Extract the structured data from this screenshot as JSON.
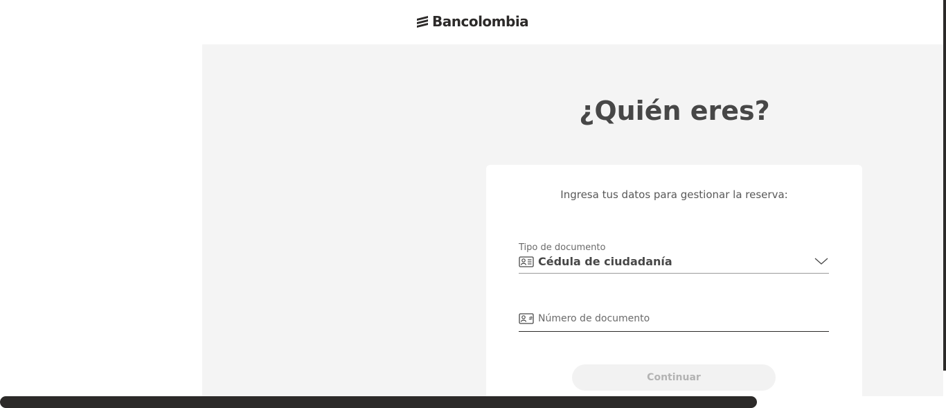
{
  "header": {
    "brand_name": "Bancolombia",
    "logo_icon": "bancolombia-logo-icon"
  },
  "page": {
    "title": "¿Quién eres?"
  },
  "form": {
    "subtitle": "Ingresa tus datos para gestionar la reserva:",
    "document_type": {
      "label": "Tipo de documento",
      "selected_value": "Cédula de ciudadanía",
      "icon": "id-card-icon",
      "dropdown_icon": "chevron-down-icon"
    },
    "document_number": {
      "value": "",
      "placeholder": "Número de documento",
      "icon": "id-card-icon"
    },
    "continue_label": "Continuar"
  },
  "colors": {
    "text_dark": "#2c2a29",
    "background_gray": "#f4f4f4",
    "card_white": "#ffffff",
    "button_disabled_bg": "#f2f2f2",
    "button_disabled_text": "#b3b3b3"
  }
}
